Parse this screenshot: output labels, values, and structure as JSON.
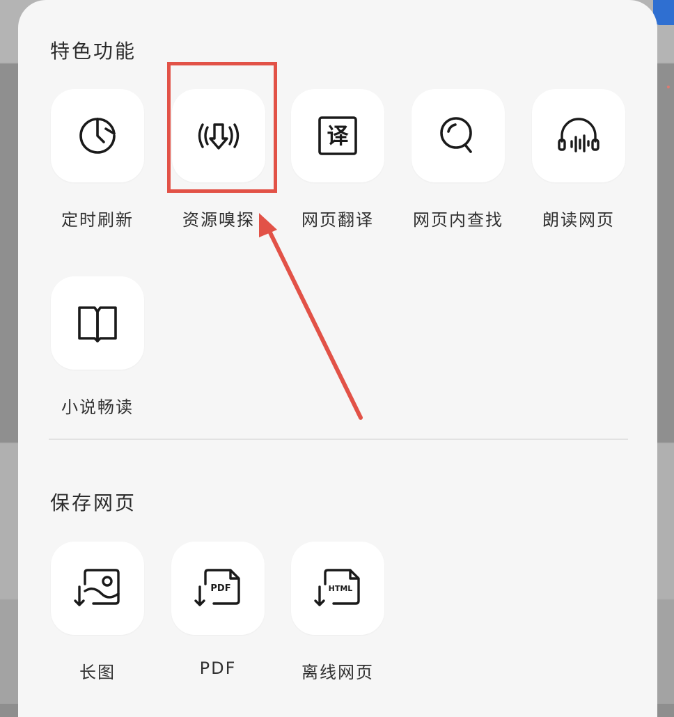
{
  "colors": {
    "sheet_bg": "#f6f6f6",
    "tile_bg": "#ffffff",
    "icon_stroke": "#1a1a1a",
    "annotation_red": "#e25247",
    "accent_blue": "#2f6fd1"
  },
  "features": {
    "title": "特色功能",
    "items": [
      {
        "label": "定时刷新",
        "icon": "clock-icon"
      },
      {
        "label": "资源嗅探",
        "icon": "resource-sniff-icon"
      },
      {
        "label": "网页翻译",
        "icon": "translate-icon"
      },
      {
        "label": "网页内查找",
        "icon": "search-icon"
      },
      {
        "label": "朗读网页",
        "icon": "headphones-icon"
      },
      {
        "label": "小说畅读",
        "icon": "book-icon"
      }
    ]
  },
  "save": {
    "title": "保存网页",
    "items": [
      {
        "label": "长图",
        "icon": "long-image-icon"
      },
      {
        "label": "PDF",
        "icon": "pdf-icon",
        "badge": "PDF"
      },
      {
        "label": "离线网页",
        "icon": "html-icon",
        "badge": "HTML"
      }
    ]
  }
}
